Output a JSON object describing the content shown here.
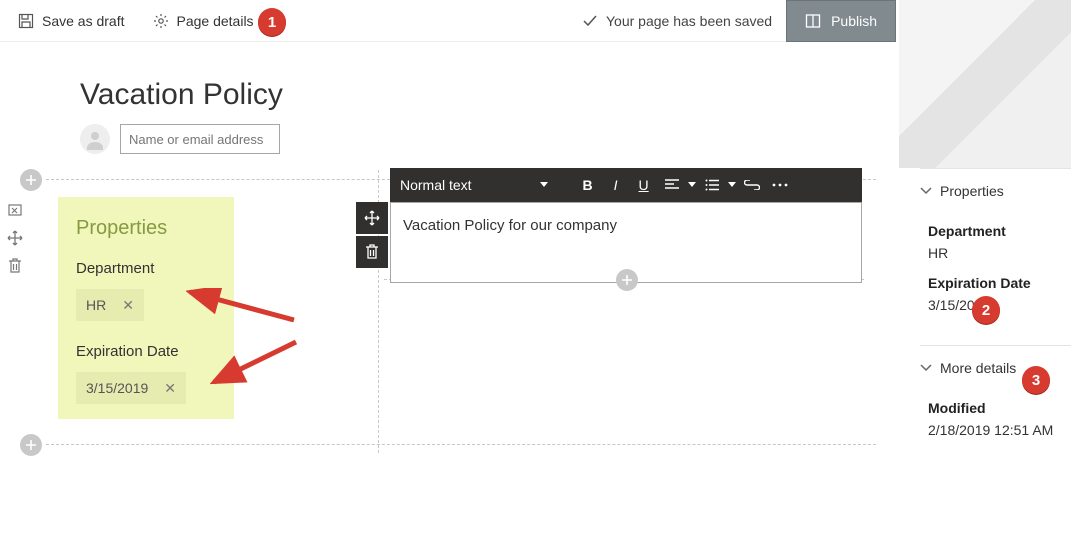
{
  "topbar": {
    "save_draft": "Save as draft",
    "page_details": "Page details",
    "saved_msg": "Your page has been saved",
    "publish": "Publish"
  },
  "page": {
    "title": "Vacation Policy",
    "author_placeholder": "Name or email address"
  },
  "webpart_props": {
    "heading": "Properties",
    "field1_label": "Department",
    "field1_value": "HR",
    "field2_label": "Expiration Date",
    "field2_value": "3/15/2019"
  },
  "rte": {
    "style_label": "Normal text",
    "content": "Vacation Policy for our company"
  },
  "right_panel": {
    "sec1_title": "Properties",
    "dept_label": "Department",
    "dept_value": "HR",
    "exp_label": "Expiration Date",
    "exp_value": "3/15/2019",
    "sec2_title": "More details",
    "mod_label": "Modified",
    "mod_value": "2/18/2019 12:51 AM"
  },
  "annotations": {
    "n1": "1",
    "n2": "2",
    "n3": "3"
  }
}
